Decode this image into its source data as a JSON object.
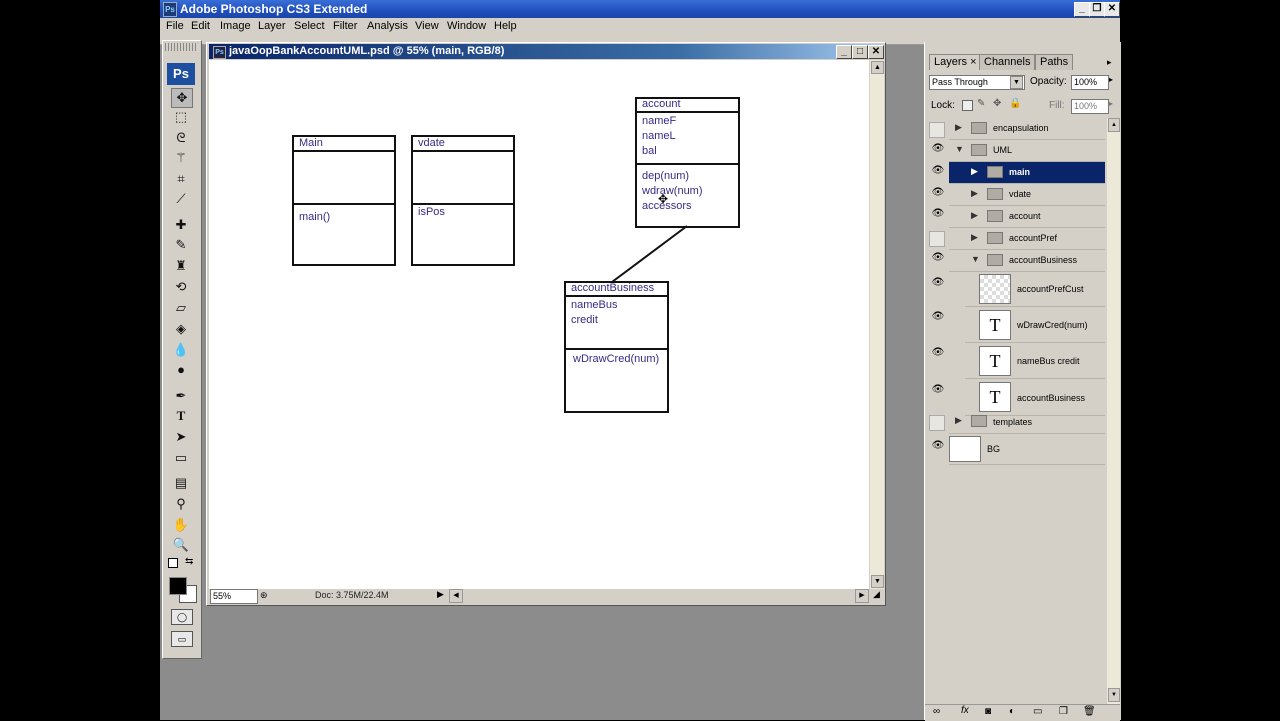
{
  "app": {
    "title": "Adobe Photoshop CS3 Extended",
    "icon": "Ps"
  },
  "menu": [
    "File",
    "Edit",
    "Image",
    "Layer",
    "Select",
    "Filter",
    "Analysis",
    "View",
    "Window",
    "Help"
  ],
  "toolbox": {
    "logo": "Ps",
    "tools": [
      "move-tool-icon",
      "marquee-tool-icon",
      "lasso-tool-icon",
      "magic-wand-icon",
      "crop-tool-icon",
      "slice-tool-icon",
      "healing-brush-icon",
      "brush-tool-icon",
      "clone-stamp-icon",
      "history-brush-icon",
      "eraser-tool-icon",
      "paint-bucket-icon",
      "blur-tool-icon",
      "dodge-tool-icon",
      "pen-tool-icon",
      "type-tool-icon",
      "path-selection-icon",
      "rectangle-tool-icon",
      "notes-tool-icon",
      "eyedropper-icon",
      "hand-tool-icon",
      "zoom-tool-icon"
    ]
  },
  "document": {
    "title": "javaOopBankAccountUML.psd @ 55% (main, RGB/8)",
    "zoom": "55%",
    "doc_info": "Doc: 3.75M/22.4M"
  },
  "uml": {
    "main": {
      "name": "Main",
      "methods": [
        "main()"
      ]
    },
    "vdate": {
      "name": "vdate",
      "methods": [
        "isPos"
      ]
    },
    "account": {
      "name": "account",
      "fields": [
        "nameF",
        "nameL",
        "bal"
      ],
      "methods": [
        "dep(num)",
        "wdraw(num)",
        "accessors"
      ]
    },
    "accountBusiness": {
      "name": "accountBusiness",
      "fields": [
        "nameBus",
        "credit"
      ],
      "methods": [
        "wDrawCred(num)"
      ]
    }
  },
  "panel": {
    "tabs": [
      "Layers",
      "Channels",
      "Paths"
    ],
    "blend_mode": "Pass Through",
    "opacity_label": "Opacity:",
    "opacity": "100%",
    "lock_label": "Lock:",
    "fill_label": "Fill:",
    "fill": "100%",
    "layers": [
      {
        "name": "encapsulation",
        "visible": false
      },
      {
        "name": "UML",
        "visible": true
      },
      {
        "name": "main",
        "visible": true
      },
      {
        "name": "vdate",
        "visible": true
      },
      {
        "name": "account",
        "visible": true
      },
      {
        "name": "accountPref",
        "visible": false
      },
      {
        "name": "accountBusiness",
        "visible": true
      },
      {
        "name": "accountPrefCust",
        "visible": true
      },
      {
        "name": "wDrawCred(num)",
        "visible": true
      },
      {
        "name": "nameBus credit",
        "visible": true
      },
      {
        "name": "accountBusiness",
        "visible": true
      },
      {
        "name": "templates",
        "visible": false
      },
      {
        "name": "BG",
        "visible": true
      }
    ],
    "text_thumb": "T"
  },
  "colors": {
    "selection": "#0a246a",
    "uml_text": "#3a2a86",
    "titlebar": "#1f4fbf"
  }
}
